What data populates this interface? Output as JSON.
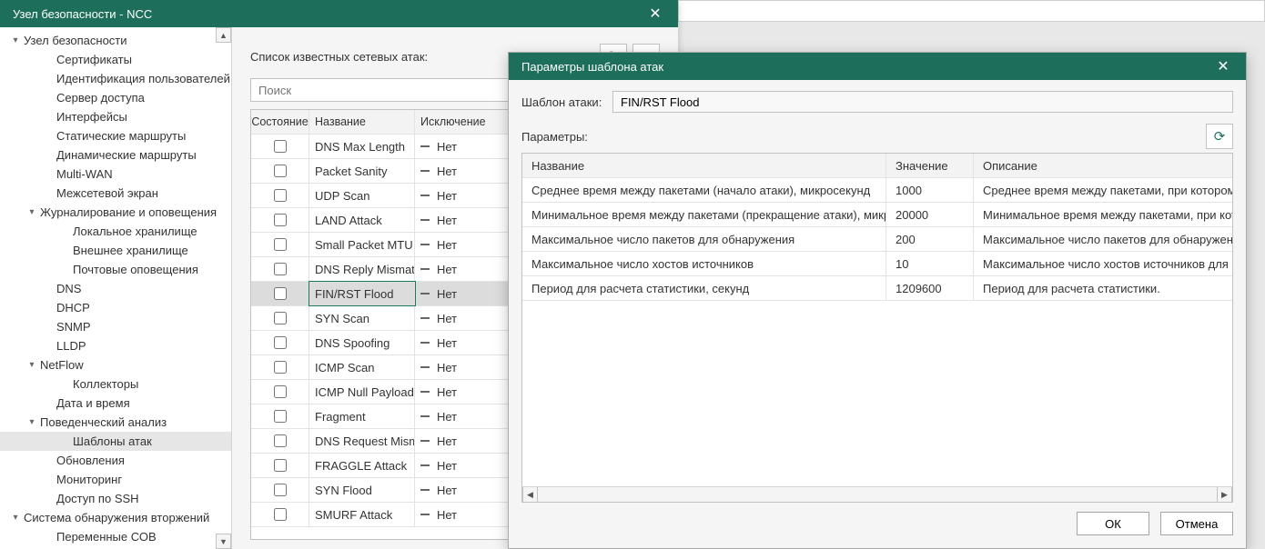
{
  "main": {
    "title": "Узел безопасности - NCC"
  },
  "tree": [
    {
      "lvl": 0,
      "arrow": "▾",
      "label": "Узел безопасности"
    },
    {
      "lvl": 2,
      "arrow": "",
      "label": "Сертификаты"
    },
    {
      "lvl": 2,
      "arrow": "",
      "label": "Идентификация пользователей"
    },
    {
      "lvl": 2,
      "arrow": "",
      "label": "Сервер доступа"
    },
    {
      "lvl": 2,
      "arrow": "",
      "label": "Интерфейсы"
    },
    {
      "lvl": 2,
      "arrow": "",
      "label": "Статические маршруты"
    },
    {
      "lvl": 2,
      "arrow": "",
      "label": "Динамические маршруты"
    },
    {
      "lvl": 2,
      "arrow": "",
      "label": "Multi-WAN"
    },
    {
      "lvl": 2,
      "arrow": "",
      "label": "Межсетевой экран"
    },
    {
      "lvl": 1,
      "arrow": "▾",
      "label": "Журналирование и оповещения"
    },
    {
      "lvl": 3,
      "arrow": "",
      "label": "Локальное хранилище"
    },
    {
      "lvl": 3,
      "arrow": "",
      "label": "Внешнее хранилище"
    },
    {
      "lvl": 3,
      "arrow": "",
      "label": "Почтовые оповещения"
    },
    {
      "lvl": 2,
      "arrow": "",
      "label": "DNS"
    },
    {
      "lvl": 2,
      "arrow": "",
      "label": "DHCP"
    },
    {
      "lvl": 2,
      "arrow": "",
      "label": "SNMP"
    },
    {
      "lvl": 2,
      "arrow": "",
      "label": "LLDP"
    },
    {
      "lvl": 1,
      "arrow": "▾",
      "label": "NetFlow"
    },
    {
      "lvl": 3,
      "arrow": "",
      "label": "Коллекторы"
    },
    {
      "lvl": 2,
      "arrow": "",
      "label": "Дата и время"
    },
    {
      "lvl": 1,
      "arrow": "▾",
      "label": "Поведенческий анализ"
    },
    {
      "lvl": 3,
      "arrow": "",
      "label": "Шаблоны атак",
      "selected": true
    },
    {
      "lvl": 2,
      "arrow": "",
      "label": "Обновления"
    },
    {
      "lvl": 2,
      "arrow": "",
      "label": "Мониторинг"
    },
    {
      "lvl": 2,
      "arrow": "",
      "label": "Доступ по SSH"
    },
    {
      "lvl": 0,
      "arrow": "▾",
      "label": "Система обнаружения вторжений"
    },
    {
      "lvl": 2,
      "arrow": "",
      "label": "Переменные СОВ"
    }
  ],
  "attacks": {
    "heading": "Список известных сетевых атак:",
    "search_placeholder": "Поиск",
    "columns": {
      "state": "Состояние",
      "name": "Название",
      "excl": "Исключение"
    },
    "excl_value": "Нет",
    "rows": [
      {
        "name": "DNS Max Length"
      },
      {
        "name": "Packet Sanity"
      },
      {
        "name": "UDP Scan"
      },
      {
        "name": "LAND Attack"
      },
      {
        "name": "Small Packet MTU"
      },
      {
        "name": "DNS Reply Mismatch"
      },
      {
        "name": "FIN/RST Flood",
        "selected": true
      },
      {
        "name": "SYN Scan"
      },
      {
        "name": "DNS Spoofing"
      },
      {
        "name": "ICMP Scan"
      },
      {
        "name": "ICMP Null Payload"
      },
      {
        "name": "Fragment"
      },
      {
        "name": "DNS Request Mismat..."
      },
      {
        "name": "FRAGGLE Attack"
      },
      {
        "name": "SYN Flood"
      },
      {
        "name": "SMURF Attack"
      }
    ]
  },
  "params": {
    "title": "Параметры шаблона атак",
    "template_label": "Шаблон атаки:",
    "template_value": "FIN/RST Flood",
    "section_label": "Параметры:",
    "columns": {
      "name": "Название",
      "value": "Значение",
      "desc": "Описание"
    },
    "rows": [
      {
        "name": "Среднее время между пакетами (начало атаки), микросекунд",
        "value": "1000",
        "desc": "Среднее время между пакетами, при котором фикси"
      },
      {
        "name": "Минимальное время между пакетами (прекращение атаки), микросекунд",
        "value": "20000",
        "desc": "Минимальное время между пакетами, при котором с"
      },
      {
        "name": "Максимальное число пакетов для обнаружения",
        "value": "200",
        "desc": "Максимальное число пакетов для обнаружения."
      },
      {
        "name": "Максимальное число хостов источников",
        "value": "10",
        "desc": "Максимальное число хостов источников для подсчет"
      },
      {
        "name": "Период для расчета статистики, секунд",
        "value": "1209600",
        "desc": "Период для расчета статистики."
      }
    ],
    "ok": "ОК",
    "cancel": "Отмена"
  }
}
